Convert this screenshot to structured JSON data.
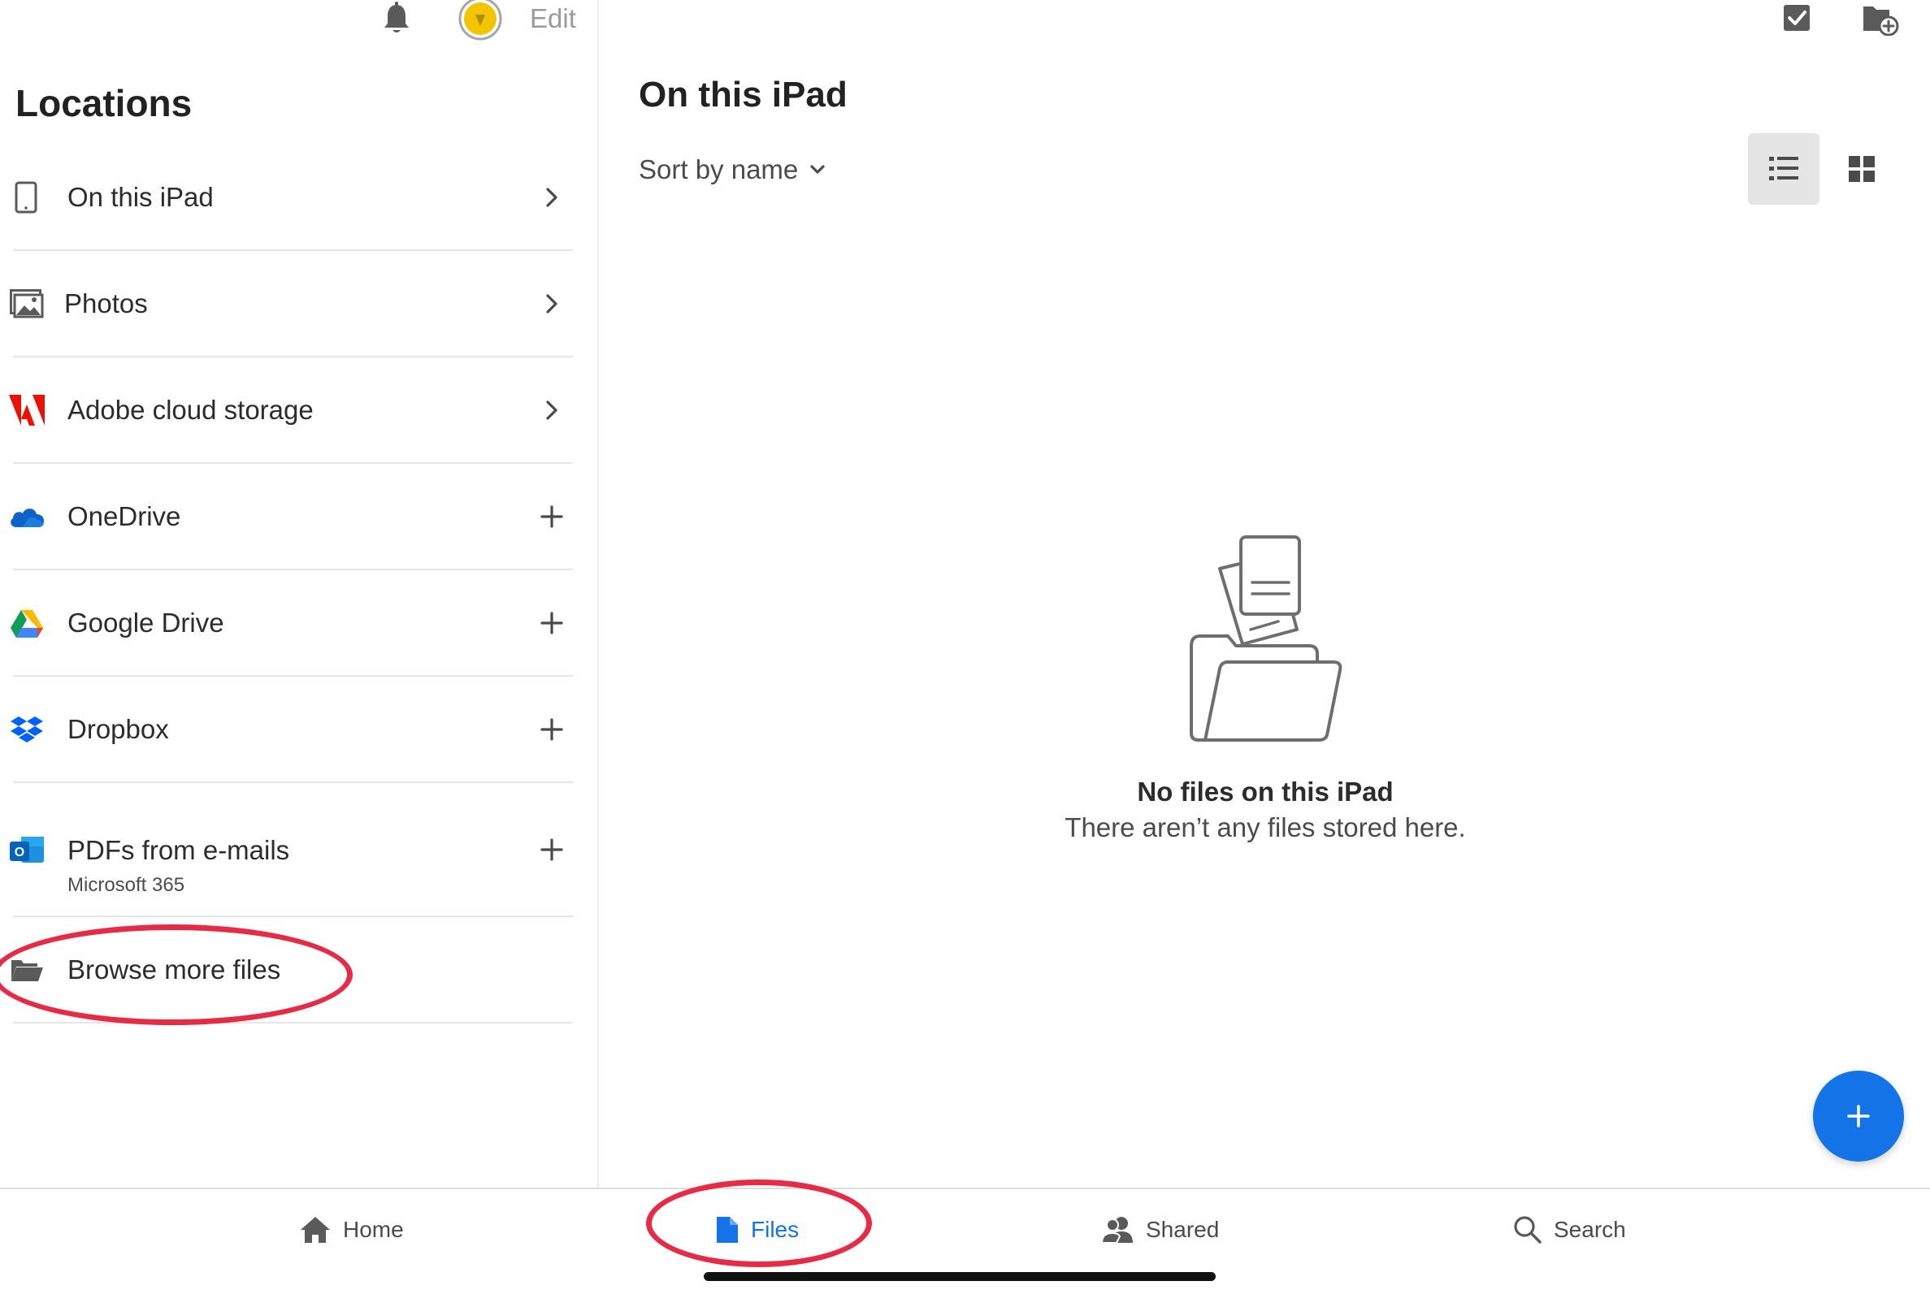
{
  "sidebar": {
    "edit_label": "Edit",
    "heading": "Locations",
    "items": [
      {
        "label": "On this iPad",
        "sublabel": "",
        "icon": "ipad-icon",
        "action": "chevron-right-icon"
      },
      {
        "label": "Photos",
        "sublabel": "",
        "icon": "photos-icon",
        "action": "chevron-right-icon"
      },
      {
        "label": "Adobe cloud storage",
        "sublabel": "",
        "icon": "adobe-icon",
        "action": "chevron-right-icon"
      },
      {
        "label": "OneDrive",
        "sublabel": "",
        "icon": "onedrive-icon",
        "action": "plus-icon"
      },
      {
        "label": "Google Drive",
        "sublabel": "",
        "icon": "google-drive-icon",
        "action": "plus-icon"
      },
      {
        "label": "Dropbox",
        "sublabel": "",
        "icon": "dropbox-icon",
        "action": "plus-icon"
      },
      {
        "label": "PDFs from e-mails",
        "sublabel": "Microsoft 365",
        "icon": "outlook-icon",
        "action": "plus-icon"
      },
      {
        "label": "Browse more files",
        "sublabel": "",
        "icon": "folder-open-icon",
        "action": ""
      }
    ]
  },
  "main": {
    "title": "On this iPad",
    "sort_label": "Sort by name",
    "empty_title": "No files on this iPad",
    "empty_subtitle": "There aren’t any files stored here."
  },
  "bottom_nav": {
    "items": [
      {
        "label": "Home",
        "icon": "home-icon",
        "active": false
      },
      {
        "label": "Files",
        "icon": "file-icon",
        "active": true
      },
      {
        "label": "Shared",
        "icon": "shared-users-icon",
        "active": false
      },
      {
        "label": "Search",
        "icon": "search-icon",
        "active": false
      }
    ]
  },
  "colors": {
    "accent": "#1473e6",
    "annotation_red": "#e52b46",
    "adobe_red": "#eb1000"
  }
}
